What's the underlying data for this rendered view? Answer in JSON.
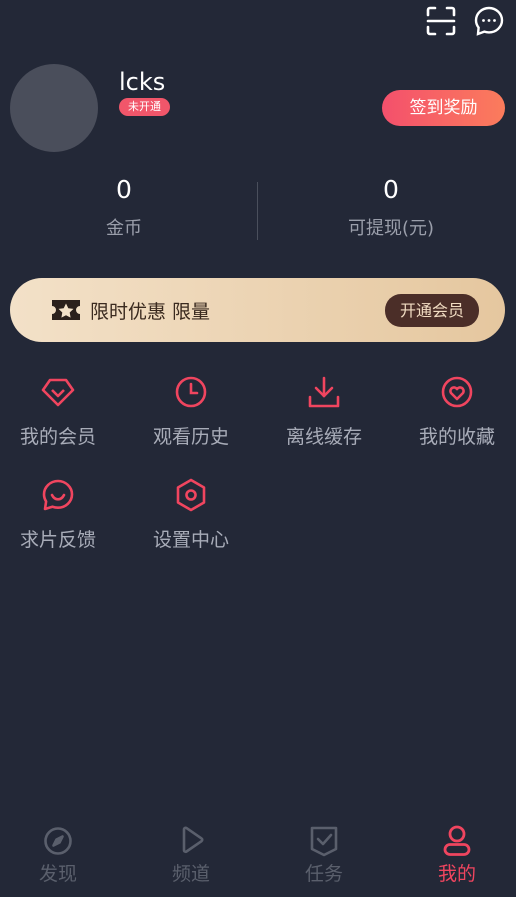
{
  "colors": {
    "background": "#232837",
    "accent": "#f0455f",
    "vip_gold": "#e5c79f"
  },
  "header": {
    "icons": [
      "scan-icon",
      "message-icon"
    ]
  },
  "profile": {
    "username": "lcks",
    "badge": "未开通",
    "checkin_label": "签到奖励"
  },
  "stats": [
    {
      "value": "0",
      "label": "金币"
    },
    {
      "value": "0",
      "label": "可提现(元)"
    }
  ],
  "vip_banner": {
    "text": "限时优惠 限量",
    "button": "开通会员"
  },
  "menu": [
    {
      "icon": "diamond-icon",
      "label": "我的会员"
    },
    {
      "icon": "clock-icon",
      "label": "观看历史"
    },
    {
      "icon": "download-icon",
      "label": "离线缓存"
    },
    {
      "icon": "heart-icon",
      "label": "我的收藏"
    },
    {
      "icon": "feedback-icon",
      "label": "求片反馈"
    },
    {
      "icon": "settings-icon",
      "label": "设置中心"
    }
  ],
  "tabbar": [
    {
      "icon": "compass-icon",
      "label": "发现",
      "active": false
    },
    {
      "icon": "play-icon",
      "label": "频道",
      "active": false
    },
    {
      "icon": "task-icon",
      "label": "任务",
      "active": false
    },
    {
      "icon": "user-icon",
      "label": "我的",
      "active": true
    }
  ]
}
